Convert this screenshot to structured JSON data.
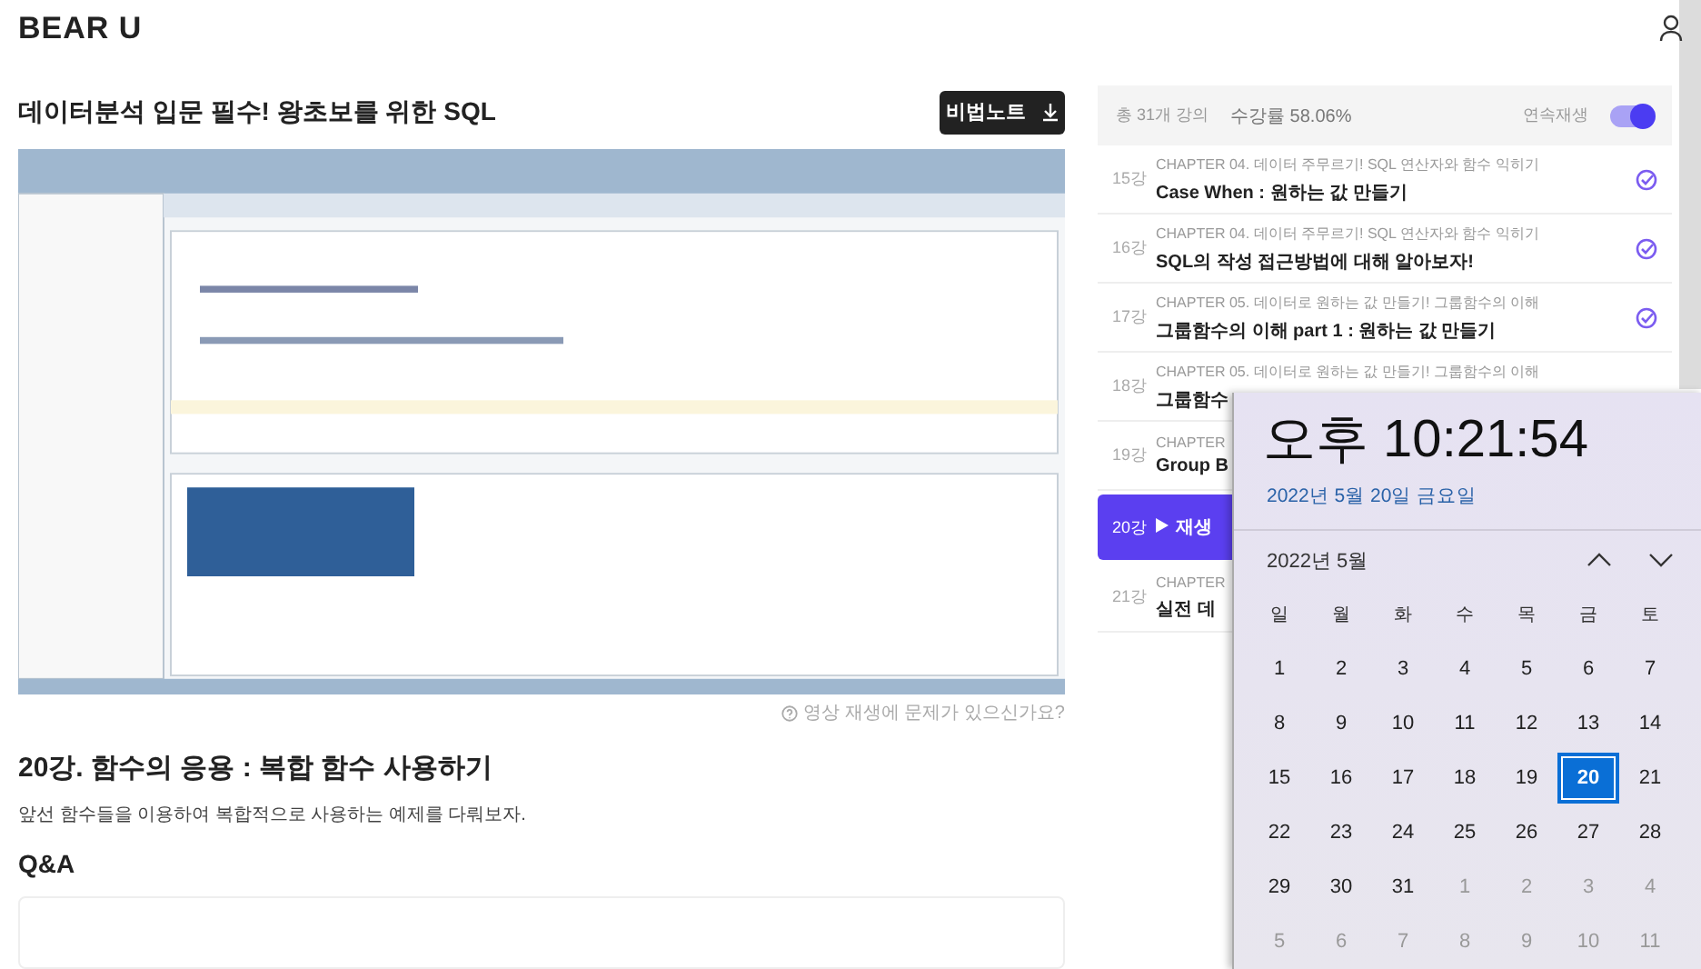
{
  "header": {
    "logo": "BEAR U"
  },
  "course": {
    "title": "데이터분석 입문 필수! 왕초보를 위한 SQL",
    "note_button": "비법노트"
  },
  "video": {
    "kind": "picture",
    "help_link": "영상 재생에 문제가 있으신가요?"
  },
  "lecture": {
    "title": "20강. 함수의 응용 : 복합 함수 사용하기",
    "description": "앞선 함수들을 이용하여 복합적으로 사용하는 예제를 다뤄보자."
  },
  "qa": {
    "heading": "Q&A"
  },
  "playlist": {
    "total": "총 31개 강의",
    "progress": "수강률 58.06%",
    "autoplay_label": "연속재생",
    "autoplay_on": true,
    "items": [
      {
        "number": "15강",
        "chapter": "CHAPTER 04. 데이터 주무르기! SQL 연산자와 함수 익히기",
        "title": "Case When : 원하는 값 만들기",
        "completed": true,
        "selected": false
      },
      {
        "number": "16강",
        "chapter": "CHAPTER 04. 데이터 주무르기! SQL 연산자와 함수 익히기",
        "title": "SQL의 작성 접근방법에 대해 알아보자!",
        "completed": true,
        "selected": false
      },
      {
        "number": "17강",
        "chapter": "CHAPTER 05. 데이터로 원하는 값 만들기! 그룹함수의 이해",
        "title": "그룹함수의 이해 part 1 : 원하는 값 만들기",
        "completed": true,
        "selected": false
      },
      {
        "number": "18강",
        "chapter": "CHAPTER 05. 데이터로 원하는 값 만들기! 그룹함수의 이해",
        "title": "그룹함수",
        "completed": false,
        "selected": false
      },
      {
        "number": "19강",
        "chapter": "CHAPTER",
        "title": "Group B",
        "completed": false,
        "selected": false
      },
      {
        "number": "20강",
        "title": "재생",
        "completed": false,
        "selected": true
      },
      {
        "number": "21강",
        "chapter": "CHAPTER",
        "title": "실전 데",
        "completed": false,
        "selected": false
      }
    ]
  },
  "clock_flyout": {
    "time": "오후 10:21:54",
    "date": "2022년 5월 20일 금요일",
    "month": "2022년 5월",
    "weekdays": [
      "일",
      "월",
      "화",
      "수",
      "목",
      "금",
      "토"
    ],
    "days": [
      {
        "day": "1",
        "muted": false,
        "selected": false
      },
      {
        "day": "2",
        "muted": false,
        "selected": false
      },
      {
        "day": "3",
        "muted": false,
        "selected": false
      },
      {
        "day": "4",
        "muted": false,
        "selected": false
      },
      {
        "day": "5",
        "muted": false,
        "selected": false
      },
      {
        "day": "6",
        "muted": false,
        "selected": false
      },
      {
        "day": "7",
        "muted": false,
        "selected": false
      },
      {
        "day": "8",
        "muted": false,
        "selected": false
      },
      {
        "day": "9",
        "muted": false,
        "selected": false
      },
      {
        "day": "10",
        "muted": false,
        "selected": false
      },
      {
        "day": "11",
        "muted": false,
        "selected": false
      },
      {
        "day": "12",
        "muted": false,
        "selected": false
      },
      {
        "day": "13",
        "muted": false,
        "selected": false
      },
      {
        "day": "14",
        "muted": false,
        "selected": false
      },
      {
        "day": "15",
        "muted": false,
        "selected": false
      },
      {
        "day": "16",
        "muted": false,
        "selected": false
      },
      {
        "day": "17",
        "muted": false,
        "selected": false
      },
      {
        "day": "18",
        "muted": false,
        "selected": false
      },
      {
        "day": "19",
        "muted": false,
        "selected": false
      },
      {
        "day": "20",
        "muted": false,
        "selected": true
      },
      {
        "day": "21",
        "muted": false,
        "selected": false
      },
      {
        "day": "22",
        "muted": false,
        "selected": false
      },
      {
        "day": "23",
        "muted": false,
        "selected": false
      },
      {
        "day": "24",
        "muted": false,
        "selected": false
      },
      {
        "day": "25",
        "muted": false,
        "selected": false
      },
      {
        "day": "26",
        "muted": false,
        "selected": false
      },
      {
        "day": "27",
        "muted": false,
        "selected": false
      },
      {
        "day": "28",
        "muted": false,
        "selected": false
      },
      {
        "day": "29",
        "muted": false,
        "selected": false
      },
      {
        "day": "30",
        "muted": false,
        "selected": false
      },
      {
        "day": "31",
        "muted": false,
        "selected": false
      },
      {
        "day": "1",
        "muted": true,
        "selected": false
      },
      {
        "day": "2",
        "muted": true,
        "selected": false
      },
      {
        "day": "3",
        "muted": true,
        "selected": false
      },
      {
        "day": "4",
        "muted": true,
        "selected": false
      },
      {
        "day": "5",
        "muted": true,
        "selected": false
      },
      {
        "day": "6",
        "muted": true,
        "selected": false
      },
      {
        "day": "7",
        "muted": true,
        "selected": false
      },
      {
        "day": "8",
        "muted": true,
        "selected": false
      },
      {
        "day": "9",
        "muted": true,
        "selected": false
      },
      {
        "day": "10",
        "muted": true,
        "selected": false
      },
      {
        "day": "11",
        "muted": true,
        "selected": false
      }
    ]
  }
}
